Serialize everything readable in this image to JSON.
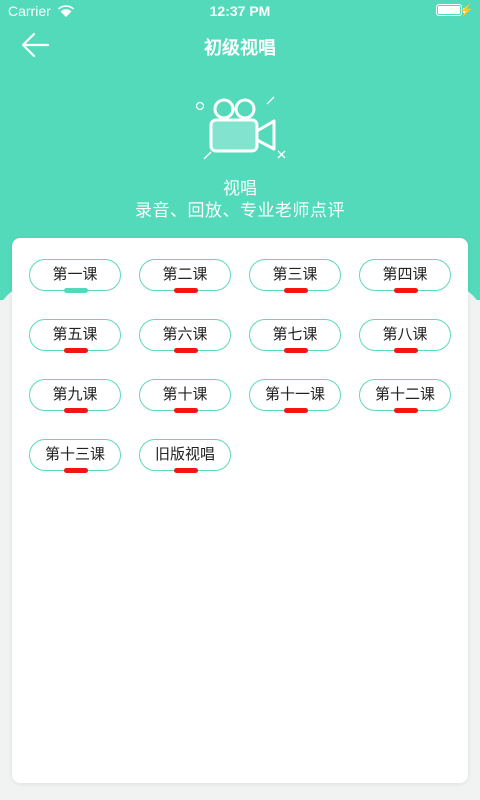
{
  "status_bar": {
    "carrier": "Carrier",
    "time": "12:37 PM",
    "battery_level": 1.0
  },
  "nav": {
    "title": "初级视唱"
  },
  "hero": {
    "title": "视唱",
    "subtitle": "录音、回放、专业老师点评"
  },
  "colors": {
    "accent": "#52dabb",
    "marker_active": "#52dabb",
    "marker_default": "#f41414"
  },
  "lessons": [
    {
      "label": "第一课",
      "active": true
    },
    {
      "label": "第二课",
      "active": false
    },
    {
      "label": "第三课",
      "active": false
    },
    {
      "label": "第四课",
      "active": false
    },
    {
      "label": "第五课",
      "active": false
    },
    {
      "label": "第六课",
      "active": false
    },
    {
      "label": "第七课",
      "active": false
    },
    {
      "label": "第八课",
      "active": false
    },
    {
      "label": "第九课",
      "active": false
    },
    {
      "label": "第十课",
      "active": false
    },
    {
      "label": "第十一课",
      "active": false
    },
    {
      "label": "第十二课",
      "active": false
    },
    {
      "label": "第十三课",
      "active": false
    },
    {
      "label": "旧版视唱",
      "active": false
    }
  ]
}
